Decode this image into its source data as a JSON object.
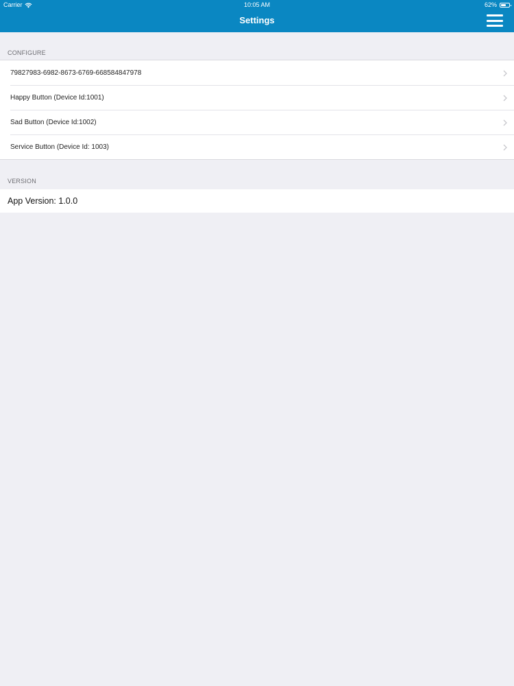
{
  "status_bar": {
    "carrier": "Carrier",
    "time": "10:05 AM",
    "battery": "62%",
    "battery_level": 0.62,
    "wifi_icon": "wifi-icon",
    "battery_icon": "battery-icon"
  },
  "nav": {
    "title": "Settings",
    "menu_icon": "hamburger-menu-icon"
  },
  "sections": {
    "configure": {
      "header": "CONFIGURE",
      "items": [
        {
          "label": "79827983-6982-8673-6769-668584847978"
        },
        {
          "label": "Happy Button (Device Id:1001)"
        },
        {
          "label": "Sad Button (Device Id:1002)"
        },
        {
          "label": "Service Button (Device Id: 1003)"
        }
      ]
    },
    "version": {
      "header": "VERSION",
      "app_version": "App Version: 1.0.0"
    }
  },
  "colors": {
    "nav_background": "#0a87c2",
    "page_background": "#efeff4",
    "section_header": "#6d6d72"
  }
}
